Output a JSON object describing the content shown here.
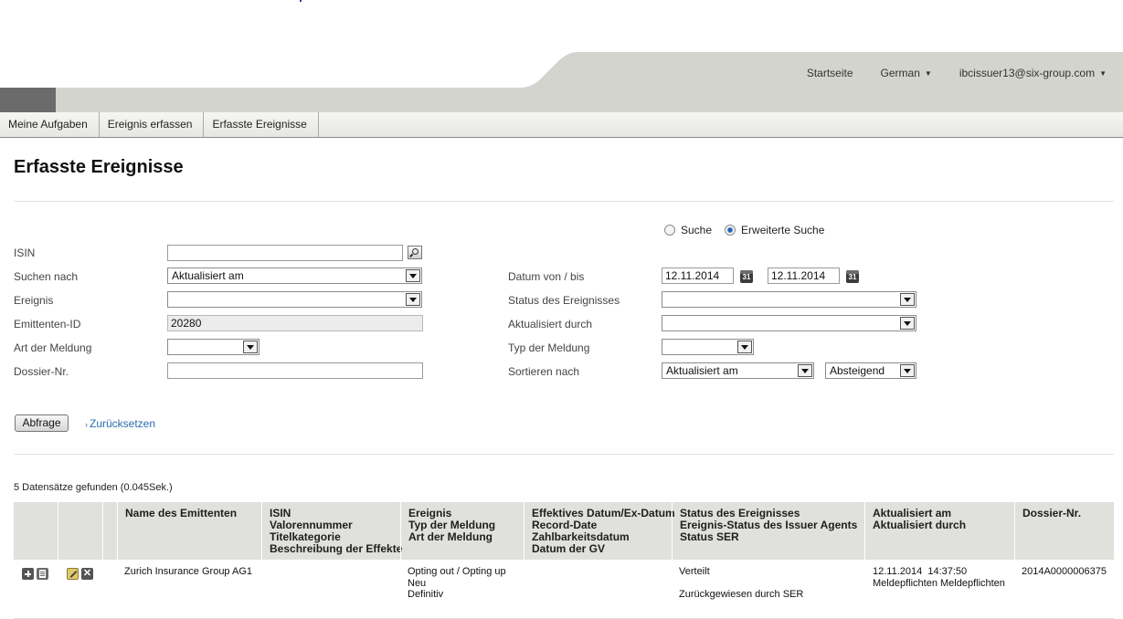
{
  "header": {
    "links": {
      "home": "Startseite",
      "language": "German",
      "user": "ibcissuer13@six-group.com"
    }
  },
  "nav": {
    "items": [
      "Meine Aufgaben",
      "Ereignis erfassen",
      "Erfasste Ereignisse"
    ]
  },
  "page": {
    "title": "Erfasste Ereignisse"
  },
  "search_mode": {
    "simple": "Suche",
    "advanced": "Erweiterte Suche",
    "selected": "advanced"
  },
  "form": {
    "isin": {
      "label": "ISIN",
      "value": ""
    },
    "search_by": {
      "label": "Suchen nach",
      "value": "Aktualisiert am"
    },
    "event": {
      "label": "Ereignis",
      "value": ""
    },
    "issuer_id": {
      "label": "Emittenten-ID",
      "value": "20280"
    },
    "notice_type": {
      "label": "Art der Meldung",
      "value": ""
    },
    "dossier": {
      "label": "Dossier-Nr.",
      "value": ""
    },
    "date_range": {
      "label": "Datum von / bis",
      "from": "12.11.2014",
      "to": "12.11.2014",
      "calendar_icon_text": "31"
    },
    "event_status": {
      "label": "Status des Ereignisses",
      "value": ""
    },
    "updated_by": {
      "label": "Aktualisiert durch",
      "value": ""
    },
    "message_type": {
      "label": "Typ der Meldung",
      "value": ""
    },
    "sort_by": {
      "label": "Sortieren nach",
      "value": "Aktualisiert am",
      "order": "Absteigend"
    }
  },
  "actions": {
    "query": "Abfrage",
    "reset": "Zurücksetzen"
  },
  "results": {
    "count_text": "5 Datensätze gefunden (0.045Sek.)",
    "columns": [
      [
        "Name des Emittenten"
      ],
      [
        "ISIN",
        "Valorennummer",
        "Titelkategorie",
        "Beschreibung der Effekte"
      ],
      [
        "Ereignis",
        "Typ der Meldung",
        "Art der Meldung"
      ],
      [
        "Effektives Datum/Ex-Datum",
        "Record-Date",
        "Zahlbarkeitsdatum",
        "Datum der GV"
      ],
      [
        "Status des Ereignisses",
        "Ereignis-Status des Issuer Agents",
        "Status SER"
      ],
      [
        "Aktualisiert am",
        "Aktualisiert durch"
      ],
      [
        "Dossier-Nr."
      ]
    ],
    "rows": [
      {
        "issuer": "Zurich Insurance Group AG1",
        "event": "Opting out / Opting up",
        "message_type": "Neu",
        "notice_type": "Definitiv",
        "status": "Verteilt",
        "status_ser": "Zurückgewiesen durch SER",
        "updated_at": "12.11.2014  14:37:50",
        "updated_by": "Meldepflichten Meldepflichten",
        "dossier": "2014A0000006375"
      }
    ]
  }
}
